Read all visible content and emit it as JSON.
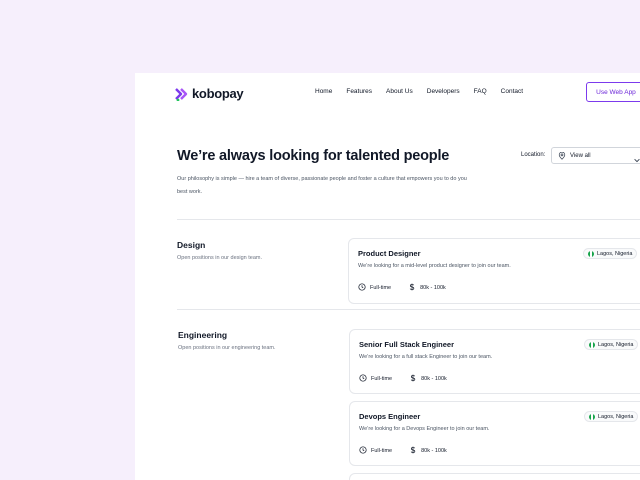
{
  "brand": {
    "name": "kobopay",
    "accent": "#7c3aed",
    "accent_secondary": "#a855f7"
  },
  "nav": {
    "items": [
      "Home",
      "Features",
      "About Us",
      "Developers",
      "FAQ",
      "Contact"
    ]
  },
  "header": {
    "cta_label": "Use Web App"
  },
  "hero": {
    "title": "We’re always looking for talented people",
    "description": "Our philosophy is simple — hire a team of diverse, passionate people and foster a culture that empowers you to do you best work."
  },
  "location_filter": {
    "label": "Location:",
    "value": "View all",
    "icon": "map-pin-icon"
  },
  "departments": [
    {
      "name": "Design",
      "description": "Open positions in our design team.",
      "jobs": [
        {
          "title": "Product Designer",
          "description": "We’re looking for a mid-level product designer to join our team.",
          "location": "Lagos, Nigeria",
          "type": "Full-time",
          "salary": "80k - 100k"
        }
      ]
    },
    {
      "name": "Engineering",
      "description": "Open positions in our engineering team.",
      "jobs": [
        {
          "title": "Senior Full Stack Engineer",
          "description": "We’re looking for a  full stack  Engineer  to join our team.",
          "location": "Lagos, Nigeria",
          "type": "Full-time",
          "salary": "80k - 100k"
        },
        {
          "title": "Devops Engineer",
          "description": "We’re looking for a  Devops Engineer  to join our team.",
          "location": "Lagos, Nigeria",
          "type": "Full-time",
          "salary": "80k - 100k"
        }
      ]
    }
  ],
  "colors": {
    "page_bg": "#f6effc",
    "card_border": "#e5e7eb",
    "flag_green": "#16a34a"
  }
}
